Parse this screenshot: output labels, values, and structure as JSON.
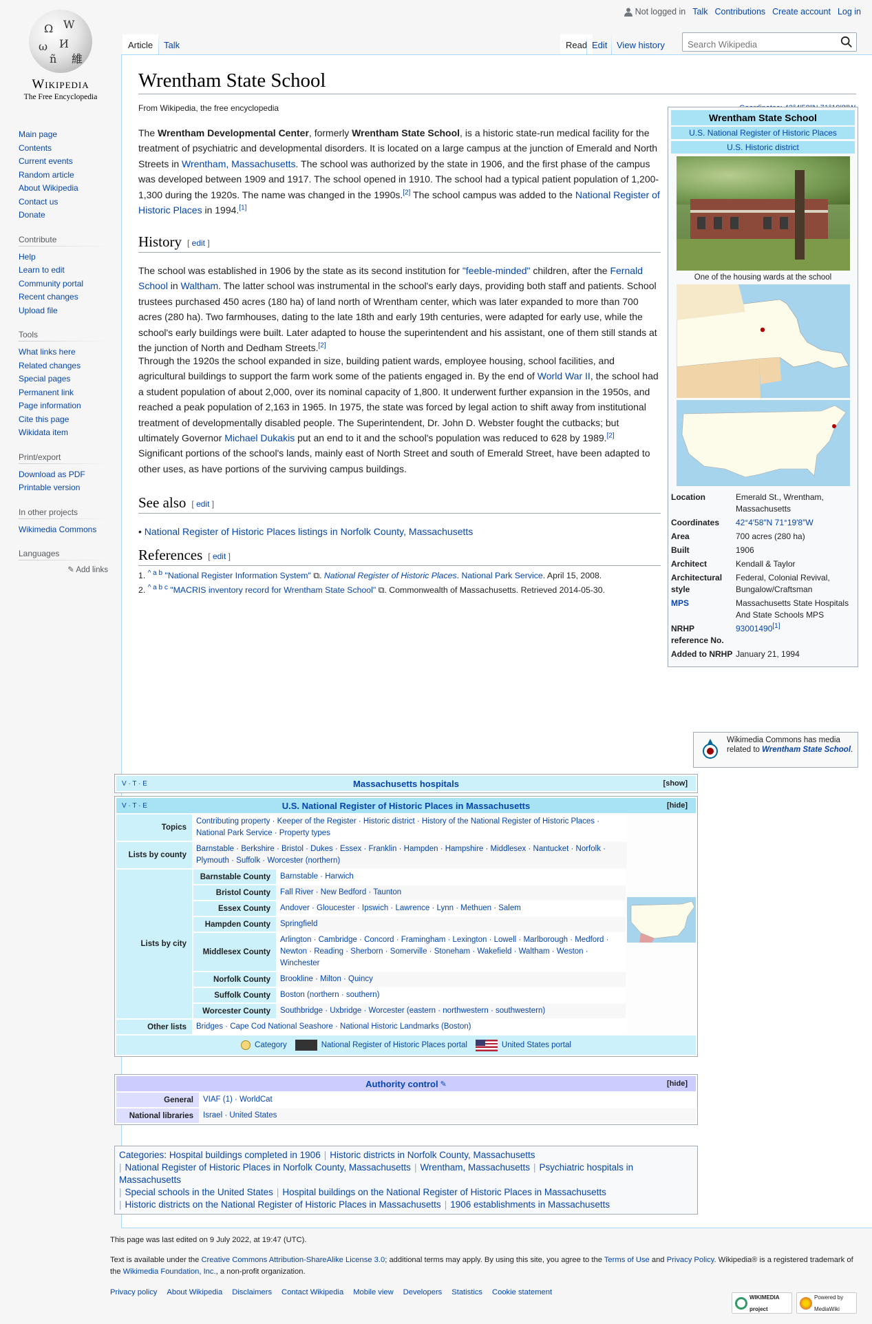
{
  "personal": {
    "not_logged_in": "Not logged in",
    "talk": "Talk",
    "contributions": "Contributions",
    "create_account": "Create account",
    "log_in": "Log in"
  },
  "logo": {
    "wordmark": "Wikipedia",
    "tagline": "The Free Encyclopedia"
  },
  "sidebar": {
    "main": [
      "Main page",
      "Contents",
      "Current events",
      "Random article",
      "About Wikipedia",
      "Contact us",
      "Donate"
    ],
    "contribute_heading": "Contribute",
    "contribute": [
      "Help",
      "Learn to edit",
      "Community portal",
      "Recent changes",
      "Upload file"
    ],
    "tools_heading": "Tools",
    "tools": [
      "What links here",
      "Related changes",
      "Special pages",
      "Permanent link",
      "Page information",
      "Cite this page",
      "Wikidata item"
    ],
    "print_heading": "Print/export",
    "print": [
      "Download as PDF",
      "Printable version"
    ],
    "projects_heading": "In other projects",
    "projects": [
      "Wikimedia Commons"
    ],
    "languages_heading": "Languages",
    "add_links": "Add links"
  },
  "tabs": {
    "article": "Article",
    "talk": "Talk",
    "read": "Read",
    "edit": "Edit",
    "history": "View history"
  },
  "search": {
    "placeholder": "Search Wikipedia"
  },
  "page": {
    "title": "Wrentham State School",
    "site_sub": "From Wikipedia, the free encyclopedia",
    "coords_label": "Coordinates",
    "coords": "42°4′58″N 71°19′8″W"
  },
  "intro": {
    "t1": "The ",
    "b1": "Wrentham Developmental Center",
    "t2": ", formerly ",
    "b2": "Wrentham State School",
    "t3": ", is a historic state-run medical facility for the treatment of psychiatric and developmental disorders. It is located on a large campus at the junction of Emerald and North Streets in ",
    "l1": "Wrentham, Massachusetts",
    "t4": ". The school was authorized by the state in 1906, and the first phase of the campus was developed between 1909 and 1917. The school opened in 1910. The school had a typical patient population of 1,200-1,300 during the 1920s. The name was changed in the 1990s.",
    "r1": "[2]",
    "t5": " The school campus was added to the ",
    "l2": "National Register of Historic Places",
    "t6": " in 1994.",
    "r2": "[1]"
  },
  "history": {
    "heading": "History",
    "edit": "edit",
    "p1a": "The school was established in 1906 by the state as its second institution for ",
    "p1l1": "\"feeble-minded\"",
    "p1b": " children, after the ",
    "p1l2": "Fernald School",
    "p1c": " in ",
    "p1l3": "Waltham",
    "p1d": ". The latter school was instrumental in the school's early days, providing both staff and patients. School trustees purchased 450 acres (180 ha) of land north of Wrentham center, which was later expanded to more than 700 acres (280 ha). Two farmhouses, dating to the late 18th and early 19th centuries, were adapted for early use, while the school's early buildings were built. Later adapted to house the superintendent and his assistant, one of them still stands at the junction of North and Dedham Streets.",
    "p1r": "[2]",
    "p2a": "Through the 1920s the school expanded in size, building patient wards, employee housing, school facilities, and agricultural buildings to support the farm work some of the patients engaged in. By the end of ",
    "p2l1": "World War II",
    "p2b": ", the school had a student population of about 2,000, over its nominal capacity of 1,800. It underwent further expansion in the 1950s, and reached a peak population of 2,163 in 1965. In 1975, the state was forced by legal action to shift away from institutional treatment of developmentally disabled people. The Superintendent, Dr. John D. Webster fought the cutbacks; but ultimately Governor ",
    "p2l2": "Michael Dukakis",
    "p2c": " put an end to it and the school's population was reduced to 628 by 1989.",
    "p2r": "[2]",
    "p2d": " Significant portions of the school's lands, mainly east of North Street and south of Emerald Street, have been adapted to other uses, as have portions of the surviving campus buildings."
  },
  "see_also": {
    "heading": "See also",
    "edit": "edit",
    "item": "National Register of Historic Places listings in Norfolk County, Massachusetts"
  },
  "references": {
    "heading": "References",
    "edit": "edit",
    "r1_link": "\"National Register Information System\"",
    "r1_pub": "National Register of Historic Places",
    "r1_org": "National Park Service",
    "r1_date": ". April 15, 2008.",
    "r2_link": "\"MACRIS inventory record for Wrentham State School\"",
    "r2_rest": ". Commonwealth of Massachusetts. Retrieved 2014-05-30.",
    "carets1": "^ a b",
    "carets2": "^ a b c"
  },
  "infobox": {
    "title": "Wrentham State School",
    "sub1": "U.S. National Register of Historic Places",
    "sub2": "U.S. Historic district",
    "photo_caption": "One of the housing wards at the school",
    "rows": [
      {
        "k": "Location",
        "v": "Emerald St., Wrentham, Massachusetts"
      },
      {
        "k": "Coordinates",
        "v": "42°4′58″N 71°19′8″W"
      },
      {
        "k": "Area",
        "v": "700 acres (280 ha)"
      },
      {
        "k": "Built",
        "v": "1906"
      },
      {
        "k": "Architect",
        "v": "Kendall & Taylor"
      },
      {
        "k": "Architectural style",
        "v": "Federal, Colonial Revival, Bungalow/Craftsman"
      },
      {
        "k": "MPS",
        "v": "Massachusetts State Hospitals And State Schools MPS"
      },
      {
        "k": "NRHP reference No.",
        "v": "93001490"
      },
      {
        "k": "Added to NRHP",
        "v": "January 21, 1994"
      }
    ],
    "nrhp_ref_sup": "[1]",
    "commons_text": "Wikimedia Commons has media related to ",
    "commons_link": "Wrentham State School",
    "commons_end": "."
  },
  "navbox1": {
    "vte": "V · T · E",
    "title": "Massachusetts hospitals",
    "toggle": "[show]"
  },
  "navbox2": {
    "vte": "V · T · E",
    "title": "U.S. National Register of Historic Places in Massachusetts",
    "toggle": "[hide]",
    "topics_label": "Topics",
    "topics": "Contributing property · Keeper of the Register · Historic district · History of the National Register of Historic Places · National Park Service · Property types",
    "county_label": "Lists by county",
    "counties": "Barnstable · Berkshire · Bristol · Dukes · Essex · Franklin · Hampden · Hampshire · Middlesex · Nantucket · Norfolk · Plymouth · Suffolk · Worcester (northern)",
    "city_label": "Lists by city",
    "cities": [
      {
        "county": "Barnstable County",
        "list": "Barnstable · Harwich"
      },
      {
        "county": "Bristol County",
        "list": "Fall River · New Bedford · Taunton"
      },
      {
        "county": "Essex County",
        "list": "Andover · Gloucester · Ipswich · Lawrence · Lynn · Methuen · Salem"
      },
      {
        "county": "Hampden County",
        "list": "Springfield"
      },
      {
        "county": "Middlesex County",
        "list": "Arlington · Cambridge · Concord · Framingham · Lexington · Lowell · Marlborough · Medford · Newton · Reading · Sherborn · Somerville · Stoneham · Wakefield · Waltham · Weston · Winchester"
      },
      {
        "county": "Norfolk County",
        "list": "Brookline · Milton · Quincy"
      },
      {
        "county": "Suffolk County",
        "list": "Boston (northern · southern)"
      },
      {
        "county": "Worcester County",
        "list": "Southbridge · Uxbridge · Worcester (eastern · northwestern · southwestern)"
      }
    ],
    "other_label": "Other lists",
    "other": "Bridges · Cape Cod National Seashore · National Historic Landmarks (Boston)",
    "portal_category": "Category",
    "portal_nrhp": "National Register of Historic Places portal",
    "portal_us": "United States portal"
  },
  "authority": {
    "title": "Authority control",
    "toggle": "[hide]",
    "general_label": "General",
    "general": "VIAF (1) · WorldCat",
    "national_label": "National libraries",
    "national": "Israel · United States"
  },
  "categories": {
    "label": "Categories",
    "items": [
      "Hospital buildings completed in 1906",
      "Historic districts in Norfolk County, Massachusetts",
      "National Register of Historic Places in Norfolk County, Massachusetts",
      "Wrentham, Massachusetts",
      "Psychiatric hospitals in Massachusetts",
      "Special schools in the United States",
      "Hospital buildings on the National Register of Historic Places in Massachusetts",
      "Historic districts on the National Register of Historic Places in Massachusetts",
      "1906 establishments in Massachusetts"
    ]
  },
  "footer": {
    "last_edited": "This page was last edited on 9 July 2022, at 19:47 (UTC).",
    "license_a": "Text is available under the ",
    "license_l": "Creative Commons Attribution-ShareAlike License 3.0",
    "license_b": "; additional terms may apply. By using this site, you agree to the ",
    "terms": "Terms of Use",
    "and": " and ",
    "privacy": "Privacy Policy",
    "license_c": ". Wikipedia® is a registered trademark of the ",
    "wmf": "Wikimedia Foundation, Inc.",
    "license_d": ", a non-profit organization.",
    "links": [
      "Privacy policy",
      "About Wikipedia",
      "Disclaimers",
      "Contact Wikipedia",
      "Mobile view",
      "Developers",
      "Statistics",
      "Cookie statement"
    ],
    "badge1": "WIKIMEDIA project",
    "badge2": "Powered by MediaWiki"
  }
}
